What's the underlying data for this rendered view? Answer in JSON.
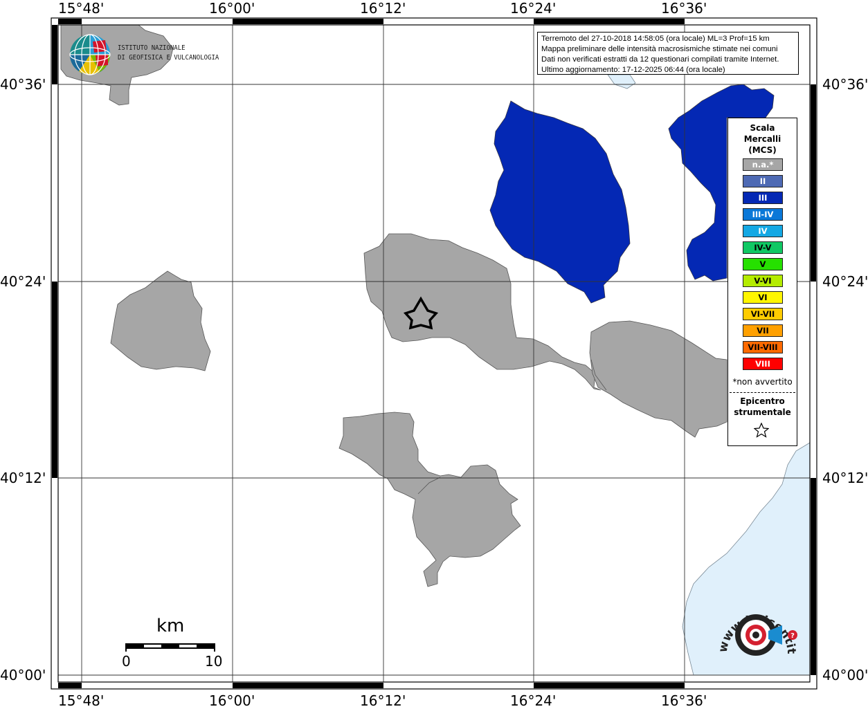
{
  "ticks": {
    "lon": [
      "15°48'",
      "16°00'",
      "16°12'",
      "16°24'",
      "16°36'"
    ],
    "lat": [
      "40°36'",
      "40°24'",
      "40°12'",
      "40°00'"
    ]
  },
  "info": {
    "line1": "Terremoto del 27-10-2018 14:58:05 (ora locale) ML=3 Prof=15 km",
    "line2": "Mappa preliminare delle intensità macrosismiche stimate nei comuni",
    "line3": "Dati non verificati estratti da 12 questionari compilati tramite Internet.",
    "line4": "Ultimo aggiornamento: 17-12-2025 06:44 (ora locale)"
  },
  "logo_ingv": {
    "line1": "ISTITUTO NAZIONALE",
    "line2": "DI GEOFISICA E VULCANOLOGIA"
  },
  "legend": {
    "title1": "Scala",
    "title2": "Mercalli",
    "title3": "(MCS)",
    "items": [
      {
        "label": "n.a.*",
        "color": "#a6a6a6"
      },
      {
        "label": "II",
        "color": "#4e6ab4"
      },
      {
        "label": "III",
        "color": "#0428b4"
      },
      {
        "label": "III-IV",
        "color": "#0a78d8"
      },
      {
        "label": "IV",
        "color": "#14a8e4"
      },
      {
        "label": "IV-V",
        "color": "#10c864"
      },
      {
        "label": "V",
        "color": "#26e000"
      },
      {
        "label": "V-VI",
        "color": "#b4ec00"
      },
      {
        "label": "VI",
        "color": "#fff600"
      },
      {
        "label": "VI-VII",
        "color": "#ffcc00"
      },
      {
        "label": "VII",
        "color": "#ffa000"
      },
      {
        "label": "VII-VIII",
        "color": "#ff6a00"
      },
      {
        "label": "VIII",
        "color": "#ff0000"
      }
    ],
    "na_note": "*non avvertito",
    "epicentro1": "Epicentro",
    "epicentro2": "strumentale"
  },
  "scalebar": {
    "unit": "km",
    "min": "0",
    "max": "10"
  },
  "colors": {
    "na": "#a6a6a6",
    "iii": "#0428b4",
    "sea": "#e0f0fb"
  },
  "logo_hs": {
    "text": "www.haisentitoilterremoto.it"
  }
}
